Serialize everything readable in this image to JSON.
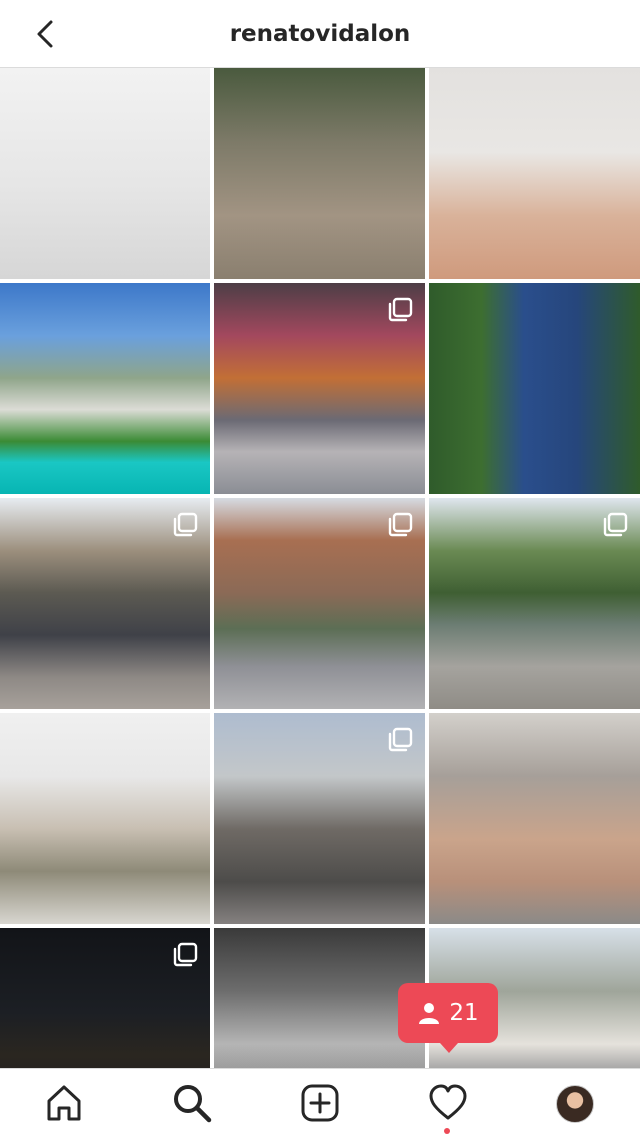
{
  "header": {
    "title": "renatovidalon",
    "back_icon": "chevron-left-icon"
  },
  "grid": {
    "posts": [
      {
        "multi": false
      },
      {
        "multi": false
      },
      {
        "multi": false
      },
      {
        "multi": false
      },
      {
        "multi": true
      },
      {
        "multi": false
      },
      {
        "multi": true
      },
      {
        "multi": true
      },
      {
        "multi": true
      },
      {
        "multi": false
      },
      {
        "multi": true
      },
      {
        "multi": false
      },
      {
        "multi": true
      },
      {
        "multi": false
      },
      {
        "multi": false
      }
    ]
  },
  "notification_badge": {
    "icon": "person-icon",
    "count": "21",
    "color": "#ed4956"
  },
  "bottom_nav": {
    "items": [
      "home-icon",
      "search-icon",
      "add-post-icon",
      "activity-heart-icon",
      "profile-avatar"
    ],
    "active": "search-icon",
    "activity_dot_color": "#ed4956"
  }
}
